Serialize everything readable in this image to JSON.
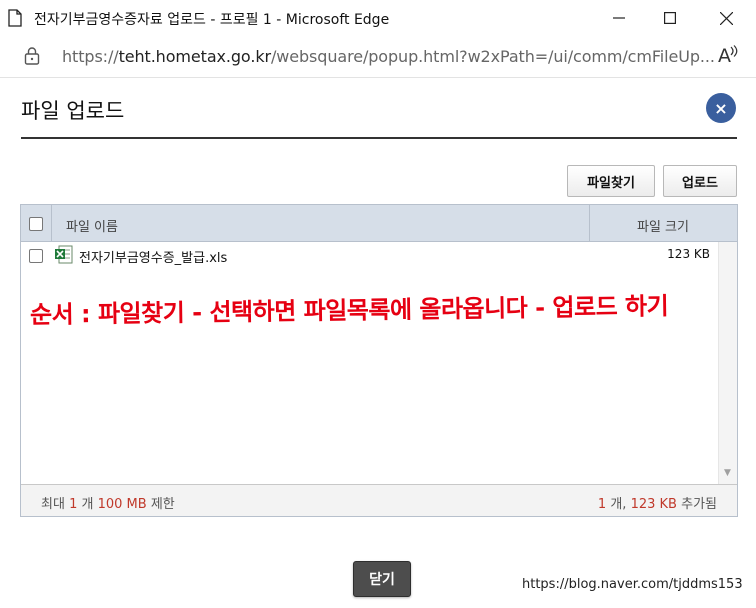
{
  "browser": {
    "window_title": "전자기부금영수증자료 업로드 - 프로필 1 - Microsoft Edge",
    "url_prefix": "https://",
    "url_host": "teht.hometax.go.kr",
    "url_path": "/websquare/popup.html?w2xPath=/ui/comm/cmFileUp...",
    "read_aloud": "A",
    "icons": [
      "document-icon",
      "minimize-icon",
      "maximize-icon",
      "close-icon",
      "lock-icon",
      "read-aloud-icon"
    ]
  },
  "dialog": {
    "title": "파일 업로드",
    "close_symbol": "×",
    "buttons": {
      "find_files": "파일찾기",
      "upload": "업로드",
      "close": "닫기"
    }
  },
  "grid": {
    "columns": {
      "name": "파일 이름",
      "size": "파일 크기"
    },
    "rows": [
      {
        "name": "전자기부금영수증_발급.xls",
        "size": "123 KB",
        "icon": "excel-file-icon"
      }
    ],
    "footer": {
      "max_prefix": "최대",
      "max_count": "1",
      "max_count_unit": "개",
      "max_size": "100 MB",
      "max_suffix": "제한",
      "added_count": "1",
      "added_count_unit": "개,",
      "added_size": "123 KB",
      "added_suffix": "추가됨"
    }
  },
  "annotation": "순서 : 파일찾기 - 선택하면 파일목록에 올라옵니다 - 업로드 하기",
  "watermark": "https://blog.naver.com/tjddms153",
  "colors": {
    "close_circle": "#3a5f9e",
    "annotation": "#e60012",
    "highlight": "#c0392b",
    "grid_header": "#d6dee8",
    "close_button": "#4d4d4d"
  }
}
